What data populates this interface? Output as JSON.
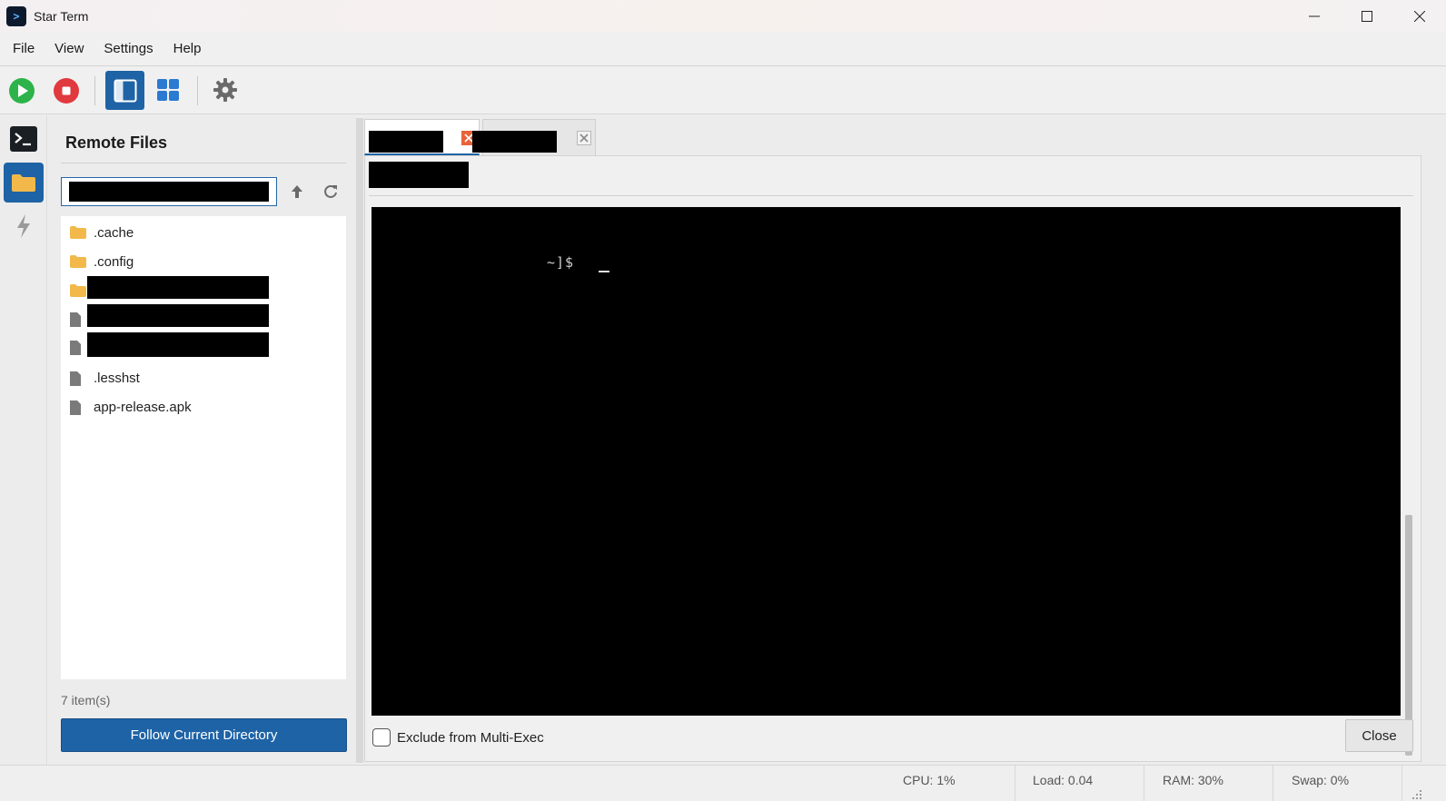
{
  "window": {
    "title": "Star Term"
  },
  "menu": {
    "items": [
      "File",
      "View",
      "Settings",
      "Help"
    ]
  },
  "toolbar": {
    "buttons": [
      {
        "icon": "play-icon",
        "color": "#2db34a"
      },
      {
        "icon": "stop-icon",
        "color": "#e0393e"
      },
      {
        "icon": "sidebar-toggle-icon",
        "color": "#1e63a6",
        "active": true
      },
      {
        "icon": "grid-layout-icon",
        "color": "#2a7ad2"
      },
      {
        "icon": "gear-icon",
        "color": "#6a6a6a"
      }
    ]
  },
  "rail": {
    "items": [
      {
        "icon": "terminal-icon"
      },
      {
        "icon": "folder-icon",
        "active": true
      },
      {
        "icon": "lightning-icon"
      }
    ]
  },
  "remote_files": {
    "title": "Remote Files",
    "path_value": "",
    "items": [
      {
        "name": ".cache",
        "type": "folder"
      },
      {
        "name": ".config",
        "type": "folder"
      },
      {
        "name": "",
        "type": "folder",
        "redacted": true
      },
      {
        "name": "",
        "type": "file",
        "redacted": true
      },
      {
        "name": "",
        "type": "file",
        "redacted": true
      },
      {
        "name": ".lesshst",
        "type": "file"
      },
      {
        "name": "app-release.apk",
        "type": "file"
      }
    ],
    "count_label": "7 item(s)",
    "follow_button": "Follow Current Directory"
  },
  "terminal": {
    "prompt": "~]$",
    "exclude_label": "Exclude from Multi-Exec",
    "close_label": "Close"
  },
  "status": {
    "cpu": "CPU: 1%",
    "load": "Load: 0.04",
    "ram": "RAM: 30%",
    "swap": "Swap: 0%"
  },
  "colors": {
    "accent": "#1e63a6",
    "folder": "#f2b94a",
    "tab_close": "#e8633a"
  }
}
